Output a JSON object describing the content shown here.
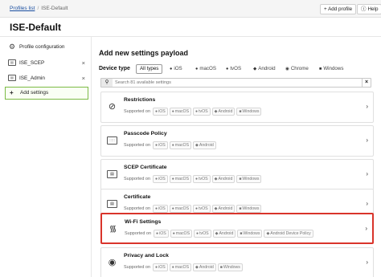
{
  "breadcrumb": {
    "link": "Profiles list",
    "separator": "/",
    "current": "ISE-Default"
  },
  "header": {
    "add_profile": "+ Add profile",
    "help": "Help"
  },
  "page_title": "ISE-Default",
  "sidebar": {
    "items": [
      {
        "label": "Profile configuration",
        "icon": "gear-icon",
        "removable": false
      },
      {
        "label": "ISE_SCEP",
        "icon": "certificate-icon",
        "removable": true
      },
      {
        "label": "ISE_Admin",
        "icon": "certificate-icon",
        "removable": true
      },
      {
        "label": "Add settings",
        "icon": "plus-icon",
        "removable": false,
        "selected": true
      }
    ],
    "remove_glyph": "×"
  },
  "main": {
    "title": "Add new settings payload",
    "device_type_label": "Device type",
    "device_types": [
      "All types",
      "iOS",
      "macOS",
      "tvOS",
      "Android",
      "Chrome",
      "Windows"
    ],
    "selected_device_type": "All types",
    "search_placeholder": "Search 81 available settings",
    "supported_on_label": "Supported on",
    "accent_color": "#d9342b",
    "settings": [
      {
        "title": "Restrictions",
        "icon": "prohibited-icon",
        "platforms": [
          "iOS",
          "macOS",
          "tvOS",
          "Android",
          "Windows"
        ]
      },
      {
        "title": "Passcode Policy",
        "icon": "keypad-icon",
        "platforms": [
          "iOS",
          "macOS",
          "Android"
        ]
      },
      {
        "title": "SCEP Certificate",
        "icon": "certificate-icon",
        "platforms": [
          "iOS",
          "macOS",
          "tvOS",
          "Android",
          "Windows"
        ]
      },
      {
        "title": "Certificate",
        "icon": "certificate-icon",
        "platforms": [
          "iOS",
          "macOS",
          "tvOS",
          "Android",
          "Windows"
        ]
      },
      {
        "title": "Wi-Fi Settings",
        "icon": "wifi-icon",
        "highlighted": true,
        "platforms": [
          "iOS",
          "macOS",
          "tvOS",
          "Android",
          "Windows",
          "Android Device Policy"
        ]
      },
      {
        "title": "Privacy and Lock",
        "icon": "eye-icon",
        "platforms": [
          "iOS",
          "macOS",
          "Android",
          "Windows"
        ]
      }
    ]
  }
}
